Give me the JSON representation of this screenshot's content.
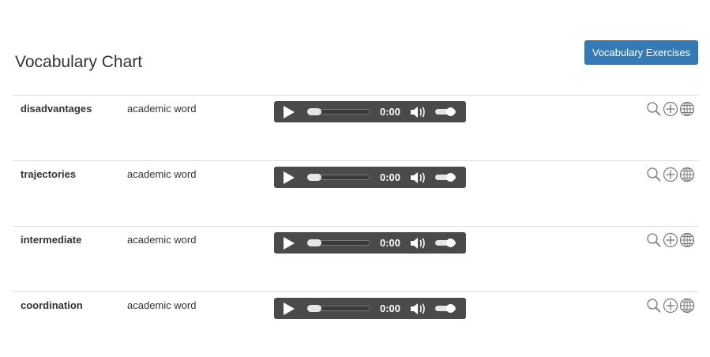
{
  "page": {
    "title": "Vocabulary Chart",
    "exercises_button": "Vocabulary Exercises"
  },
  "vocab": [
    {
      "word": "disadvantages",
      "type": "academic word",
      "time": "0:00"
    },
    {
      "word": "trajectories",
      "type": "academic word",
      "time": "0:00"
    },
    {
      "word": "intermediate",
      "type": "academic word",
      "time": "0:00"
    },
    {
      "word": "coordination",
      "type": "academic word",
      "time": "0:00"
    }
  ],
  "colors": {
    "button": "#337ab7",
    "player_bg": "#4a4a4a",
    "icon": "#777777"
  },
  "icons": [
    "search-icon",
    "add-icon",
    "globe-icon"
  ]
}
